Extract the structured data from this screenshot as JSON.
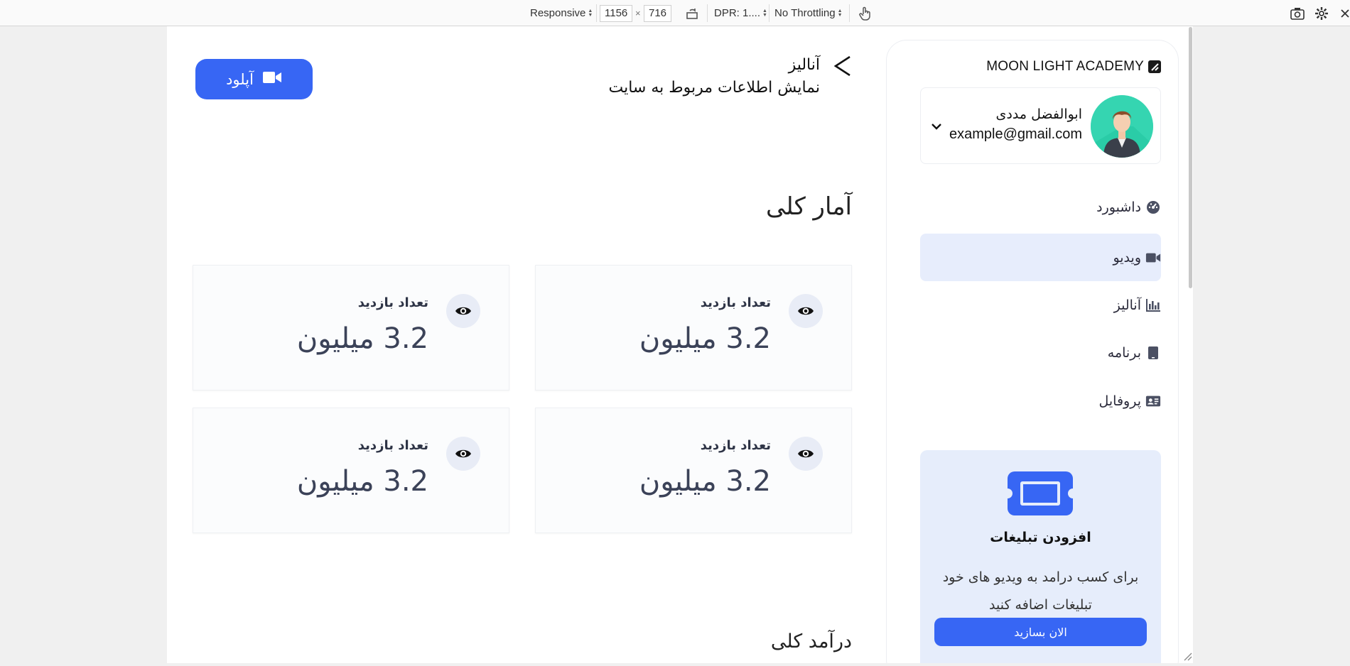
{
  "devtools": {
    "device": "Responsive",
    "width": "1156",
    "height": "716",
    "dpr": "DPR: 1....",
    "throttling": "No Throttling",
    "times": "×"
  },
  "sidebar": {
    "brand": "MOON LIGHT ACADEMY",
    "user": {
      "name": "ابوالفضل مددی",
      "email": "example@gmail.com"
    },
    "nav": [
      {
        "label": "داشبورد",
        "icon": "gauge-icon",
        "active": false
      },
      {
        "label": "ویدیو",
        "icon": "video-camera-icon",
        "active": true
      },
      {
        "label": "آنالیز",
        "icon": "bar-chart-icon",
        "active": false
      },
      {
        "label": "برنامه",
        "icon": "tablet-icon",
        "active": false
      },
      {
        "label": "پروفایل",
        "icon": "id-card-icon",
        "active": false
      }
    ],
    "promo": {
      "title": "افزودن تبلیغات",
      "text": "برای کسب درامد به ویدیو های خود تبلیغات اضافه کنید",
      "button": "الان بسازید"
    }
  },
  "header": {
    "title": "آنالیز",
    "subtitle": "نمایش اطلاعات مربوط به سایت",
    "upload": "آپلود"
  },
  "main": {
    "overview_title": "آمار کلی",
    "stats": [
      {
        "label": "تعداد بازدید",
        "value": "3.2 میلیون"
      },
      {
        "label": "تعداد بازدید",
        "value": "3.2 میلیون"
      },
      {
        "label": "تعداد بازدید",
        "value": "3.2 میلیون"
      },
      {
        "label": "تعداد بازدید",
        "value": "3.2 میلیون"
      }
    ],
    "income_title": "درآمد کلی"
  },
  "colors": {
    "accent": "#3766f4",
    "active_bg": "#e7edfc",
    "promo_bg": "#e6edfb"
  }
}
